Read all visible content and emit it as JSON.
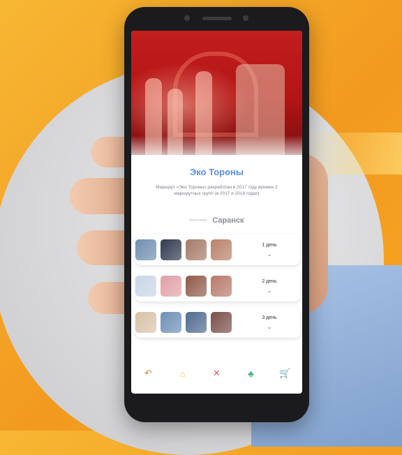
{
  "app": {
    "title": "Эко Тороны",
    "description": "Маршрут «Эко Тороны» разработан в 2017 году времен 2 маршрутных групп (в 2017 и 2018 годах)",
    "switch": {
      "off_label": "Монголия",
      "on_label": "Саранск"
    }
  },
  "days": [
    {
      "label": "1 день",
      "thumb_colors": [
        "#6f8fb0",
        "#2f3a4e",
        "#a57a68",
        "#b9826a"
      ]
    },
    {
      "label": "2 день",
      "thumb_colors": [
        "#c8d6e8",
        "#e0a0a6",
        "#8f5a4a",
        "#b87a6a"
      ]
    },
    {
      "label": "3 день",
      "thumb_colors": [
        "#d8c2a8",
        "#6c8fb5",
        "#4f6b8f",
        "#7a4f4a"
      ]
    }
  ],
  "nav": [
    {
      "name": "back-icon",
      "glyph": "↶",
      "color": "#e07a3a"
    },
    {
      "name": "home-icon",
      "glyph": "⌂",
      "color": "#f0c060"
    },
    {
      "name": "tools-icon",
      "glyph": "✕",
      "color": "#e06060"
    },
    {
      "name": "tree-icon",
      "glyph": "♣",
      "color": "#4caf7a"
    },
    {
      "name": "cart-icon",
      "glyph": "🛒",
      "color": "#5b8fe0"
    }
  ],
  "colors": {
    "accent": "#5b8fe0",
    "hero_red": "#c21e1e",
    "background_orange": "#f5a623"
  }
}
